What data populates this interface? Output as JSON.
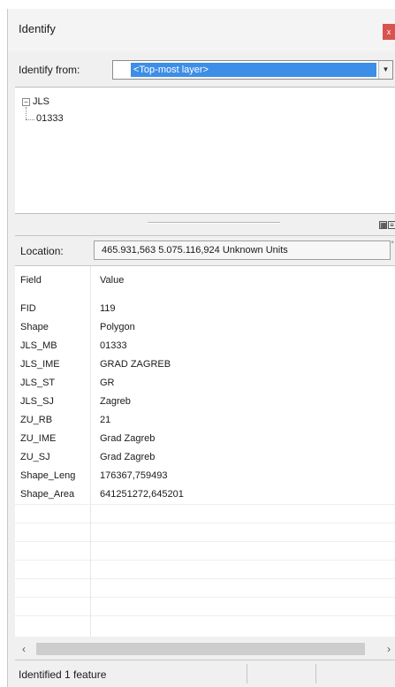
{
  "window": {
    "title": "Identify",
    "close_label": "x"
  },
  "identify_from": {
    "label": "Identify from:",
    "selected": "<Top-most layer>"
  },
  "tree": {
    "root": "JLS",
    "child": "01333"
  },
  "location": {
    "label": "Location:",
    "value": "465.931,563  5.075.116,924 Unknown Units"
  },
  "table": {
    "headers": [
      "Field",
      "Value"
    ],
    "rows": [
      {
        "field": "FID",
        "value": "119"
      },
      {
        "field": "Shape",
        "value": "Polygon"
      },
      {
        "field": "JLS_MB",
        "value": "01333"
      },
      {
        "field": "JLS_IME",
        "value": "GRAD ZAGREB"
      },
      {
        "field": "JLS_ST",
        "value": "GR"
      },
      {
        "field": "JLS_SJ",
        "value": "Zagreb"
      },
      {
        "field": "ZU_RB",
        "value": "21"
      },
      {
        "field": "ZU_IME",
        "value": "Grad Zagreb"
      },
      {
        "field": "ZU_SJ",
        "value": "Grad Zagreb"
      },
      {
        "field": "Shape_Leng",
        "value": "176367,759493"
      },
      {
        "field": "Shape_Area",
        "value": "641251272,645201"
      }
    ]
  },
  "status": {
    "text": "Identified 1 feature"
  }
}
